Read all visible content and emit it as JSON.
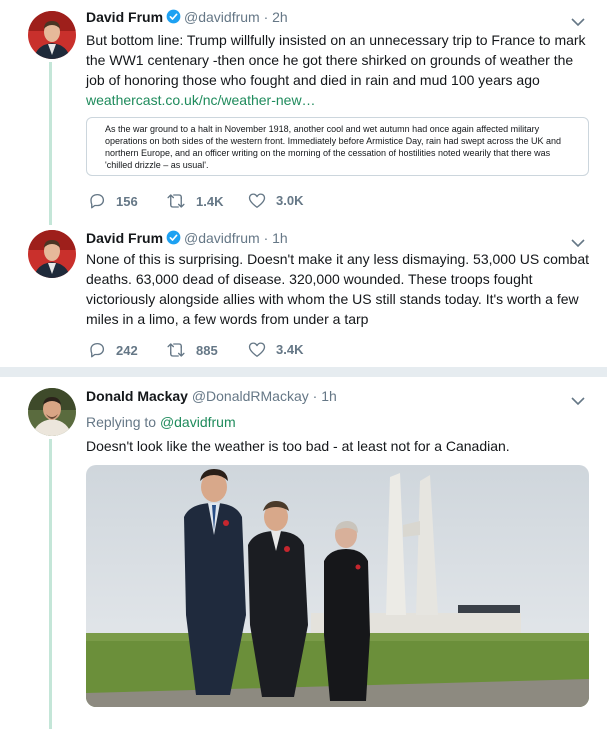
{
  "tweets": [
    {
      "name": "David Frum",
      "handle": "@davidfrum",
      "time": "· 2h",
      "text": "But bottom line: Trump willfully insisted on an unnecessary trip to France to mark the WW1 centenary -then once he got there shirked on grounds of weather the job of honoring those who fought and died in rain and mud 100 years ago",
      "link": "weathercast.co.uk/nc/weather-new…",
      "card_text": "As the war ground to a halt in November 1918, another cool and wet autumn had once again affected military operations on both sides of the western front. Immediately before Armistice Day, rain had swept across the UK and northern Europe, and an officer writing on the morning of the cessation of hostilities noted wearily that there was 'chilled drizzle – as usual'.",
      "replies": "156",
      "retweets": "1.4K",
      "likes": "3.0K"
    },
    {
      "name": "David Frum",
      "handle": "@davidfrum",
      "time": "· 1h",
      "text": "None of this is surprising. Doesn't make it any less dismaying. 53,000 US combat deaths. 63,000 dead of disease. 320,000 wounded. These troops fought victoriously alongside allies with whom the US still stands today. It's worth a few miles in a limo, a few words from under a tarp",
      "replies": "242",
      "retweets": "885",
      "likes": "3.4K"
    },
    {
      "name": "Donald Mackay",
      "handle": "@DonaldRMackay",
      "time": "· 1h",
      "replying_label": "Replying to",
      "replying_to": "@davidfrum",
      "text": "Doesn't look like the weather is too bad - at least not for a Canadian."
    }
  ],
  "icons": {
    "verified": "verified-badge-icon",
    "reply": "reply-icon",
    "retweet": "retweet-icon",
    "like": "heart-icon",
    "caret": "chevron-down-icon"
  },
  "colors": {
    "link": "#1f8b5c",
    "thread_line": "#c4e6d8",
    "verified": "#1da1f2",
    "muted": "#657786"
  }
}
